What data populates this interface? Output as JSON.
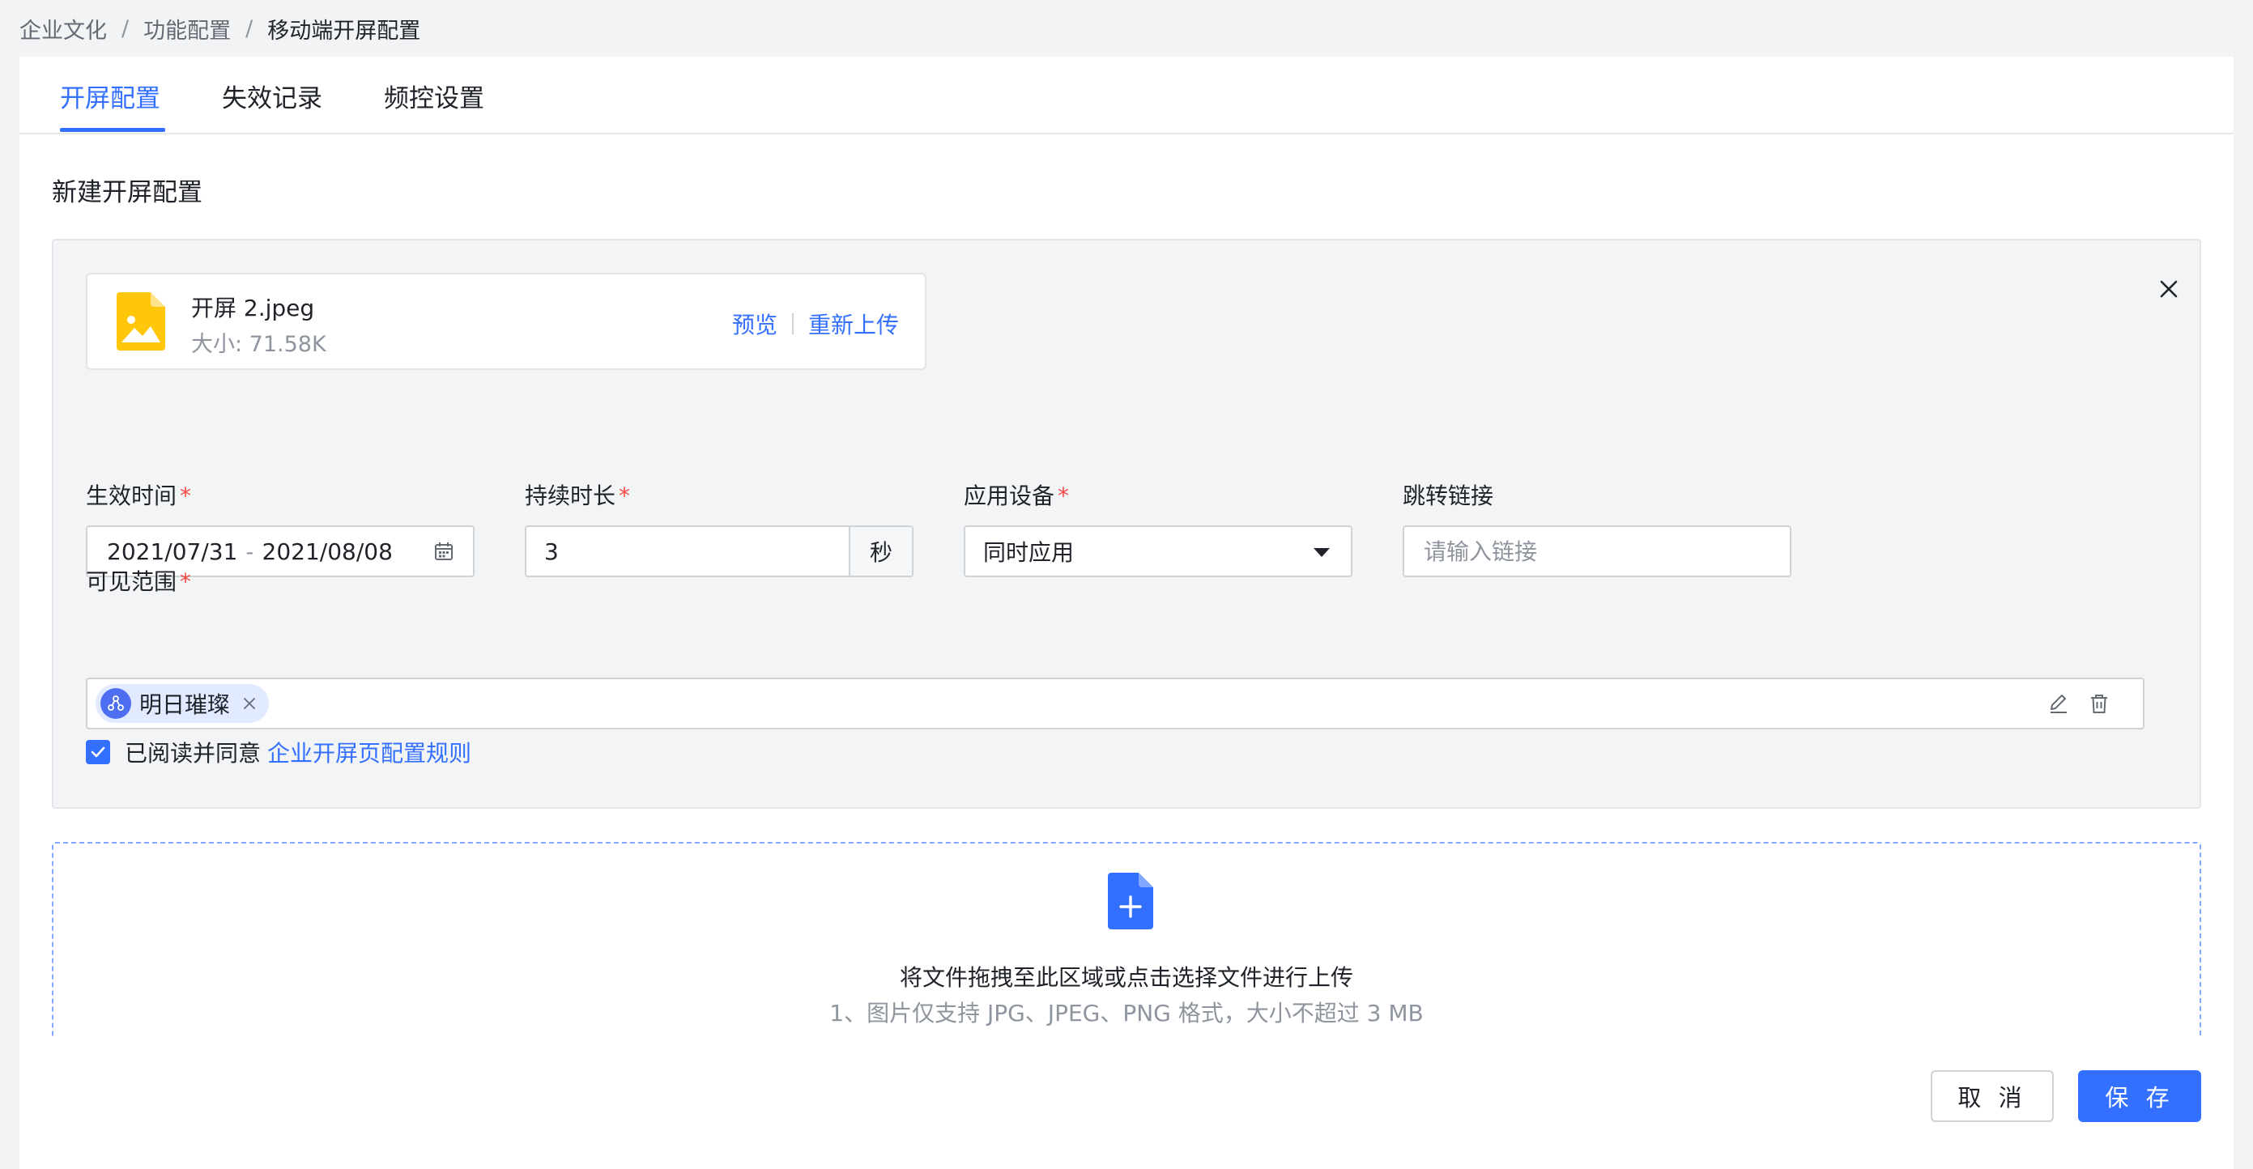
{
  "breadcrumb": {
    "items": [
      "企业文化",
      "功能配置",
      "移动端开屏配置"
    ],
    "separator": "/"
  },
  "tabs": [
    {
      "label": "开屏配置",
      "active": true
    },
    {
      "label": "失效记录",
      "active": false
    },
    {
      "label": "频控设置",
      "active": false
    }
  ],
  "section_title": "新建开屏配置",
  "file": {
    "name": "开屏 2.jpeg",
    "size_text": "大小: 71.58K",
    "preview_label": "预览",
    "reupload_label": "重新上传",
    "icon": "image-file-icon"
  },
  "form": {
    "effective_time": {
      "label": "生效时间",
      "required": "*",
      "start": "2021/07/31",
      "separator": "-",
      "end": "2021/08/08"
    },
    "duration": {
      "label": "持续时长",
      "required": "*",
      "value": "3",
      "unit": "秒"
    },
    "device": {
      "label": "应用设备",
      "required": "*",
      "value": "同时应用"
    },
    "link": {
      "label": "跳转链接",
      "placeholder": "请输入链接",
      "value": ""
    },
    "scope": {
      "label": "可见范围",
      "required": "*",
      "tags": [
        {
          "label": "明日璀璨"
        }
      ]
    }
  },
  "agreement": {
    "checked": true,
    "text": "已阅读并同意",
    "link_text": "企业开屏页配置规则"
  },
  "upload": {
    "main_text": "将文件拖拽至此区域或点击选择文件进行上传",
    "hint_1": "1、图片仅支持 JPG、JPEG、PNG 格式，大小不超过 3 MB"
  },
  "footer": {
    "cancel_label": "取 消",
    "save_label": "保 存"
  },
  "colors": {
    "primary": "#3370ff",
    "required": "#f54a45",
    "file_icon": "#ffc60a",
    "tag_bg": "#e1eaff"
  }
}
